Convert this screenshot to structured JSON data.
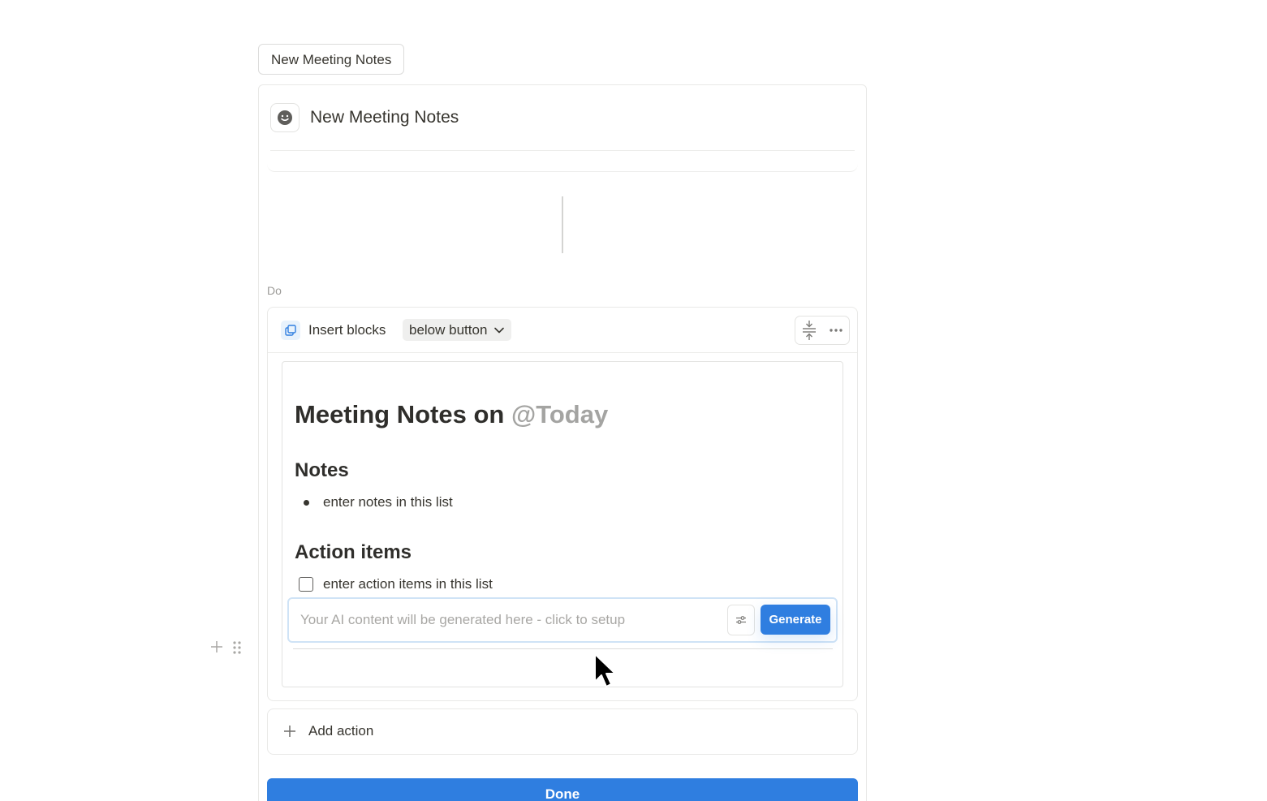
{
  "button_name_chip": "New Meeting Notes",
  "title_card": {
    "icon": "smiley-face-icon",
    "title": "New Meeting Notes"
  },
  "do_label": "Do",
  "action": {
    "icon": "copy-blocks-icon",
    "label": "Insert blocks",
    "position_value": "below button",
    "tools": [
      "collapse-icon",
      "more-icon"
    ]
  },
  "template": {
    "heading_prefix": "Meeting Notes on",
    "heading_mention": "@Today",
    "notes_heading": "Notes",
    "notes_item": "enter notes in this list",
    "action_items_heading": "Action items",
    "action_item": "enter action items in this list",
    "ai_placeholder": "Your AI content will be generated here - click to setup",
    "ai_settings_icon": "sliders-icon",
    "generate_label": "Generate"
  },
  "add_action_label": "Add action",
  "done_label": "Done",
  "colors": {
    "accent": "#2f7ee0",
    "text": "#37352f",
    "muted": "#9b9a97"
  }
}
